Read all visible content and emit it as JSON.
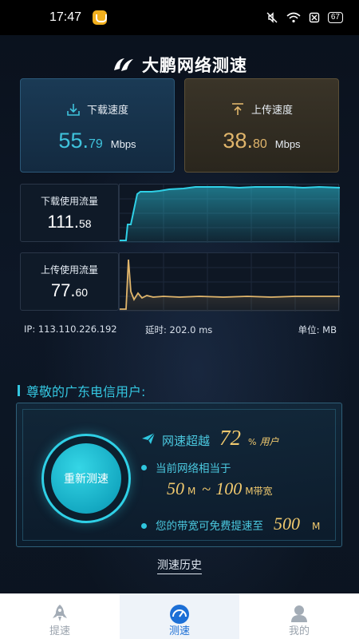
{
  "status_bar": {
    "time": "17:47",
    "battery": "67"
  },
  "app": {
    "title": "大鹏网络测速"
  },
  "speed": {
    "download": {
      "label": "下载速度",
      "int": "55.",
      "dec": "79",
      "unit": "Mbps"
    },
    "upload": {
      "label": "上传速度",
      "int": "38.",
      "dec": "80",
      "unit": "Mbps"
    }
  },
  "traffic": {
    "download": {
      "label": "下载使用流量",
      "int": "111.",
      "dec": "58"
    },
    "upload": {
      "label": "上传使用流量",
      "int": "77.",
      "dec": "60"
    }
  },
  "info": {
    "ip": "IP: 113.110.226.192",
    "latency": "延时: 202.0 ms",
    "unit": "单位: MB"
  },
  "greeting": "尊敬的广东电信用户:",
  "result": {
    "retest_label": "重新测速",
    "beat_prefix": "网速超越",
    "beat_value": "72",
    "beat_unit": "%",
    "beat_suffix": "用户",
    "equiv_label": "当前网络相当于",
    "bw_low": "50",
    "bw_low_unit": "M",
    "tilde": "~",
    "bw_high": "100",
    "bw_high_unit": "M带宽",
    "upgrade_label": "您的带宽可免费提速至",
    "upgrade_value": "500",
    "upgrade_unit": "M"
  },
  "history_link": "测速历史",
  "nav": [
    {
      "label": "提速",
      "icon": "rocket-icon"
    },
    {
      "label": "测速",
      "icon": "speedometer-icon"
    },
    {
      "label": "我的",
      "icon": "user-icon"
    }
  ],
  "colors": {
    "accent": "#2fc6de",
    "gold": "#f0c96e",
    "download": "#3fc3dc",
    "upload": "#e0b56b"
  }
}
